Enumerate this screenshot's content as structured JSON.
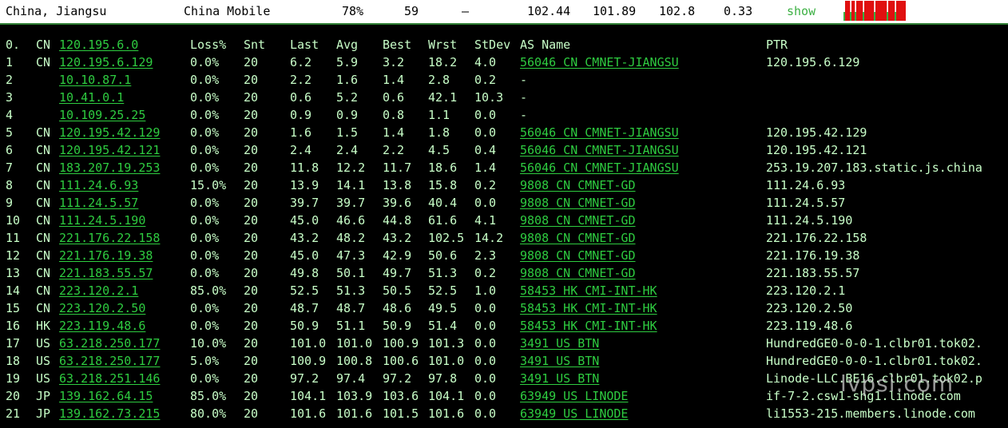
{
  "topbar": {
    "location": "China, Jiangsu",
    "carrier": "China Mobile",
    "loss": "78%",
    "sent": "59",
    "dash": "–",
    "v1": "102.44",
    "v2": "101.89",
    "v3": "102.8",
    "v4": "0.33",
    "show": "show"
  },
  "sparkline": [
    0,
    1,
    1,
    1,
    0,
    1,
    1,
    0,
    1,
    1,
    1,
    1,
    0,
    1,
    1,
    1,
    1,
    1,
    1,
    0,
    1,
    1,
    1,
    1,
    1,
    1,
    1,
    0,
    1,
    1,
    1,
    1,
    0,
    1,
    1,
    1,
    1,
    1,
    1
  ],
  "colors": {
    "bg": "#000000",
    "text": "#c8ffc8",
    "link": "#2ecc40",
    "spark_red": "#e01010",
    "spark_green": "#3cb043"
  },
  "headers": {
    "hop": "0.",
    "cc": "CN",
    "ip": "120.195.6.0",
    "loss": "Loss%",
    "snt": "Snt",
    "last": "Last",
    "avg": "Avg",
    "best": "Best",
    "wrst": "Wrst",
    "stdev": "StDev",
    "as": "AS Name",
    "ptr": "PTR"
  },
  "rows": [
    {
      "hop": "1",
      "cc": "CN",
      "ip": "120.195.6.129",
      "loss": "0.0%",
      "snt": "20",
      "last": "6.2",
      "avg": "5.9",
      "best": "3.2",
      "wrst": "18.2",
      "stdev": "4.0",
      "as": "56046 CN CMNET-JIANGSU",
      "ptr": "120.195.6.129"
    },
    {
      "hop": "2",
      "cc": "",
      "ip": "10.10.87.1",
      "loss": "0.0%",
      "snt": "20",
      "last": "2.2",
      "avg": "1.6",
      "best": "1.4",
      "wrst": "2.8",
      "stdev": "0.2",
      "as": "-",
      "ptr": ""
    },
    {
      "hop": "3",
      "cc": "",
      "ip": "10.41.0.1",
      "loss": "0.0%",
      "snt": "20",
      "last": "0.6",
      "avg": "5.2",
      "best": "0.6",
      "wrst": "42.1",
      "stdev": "10.3",
      "as": "-",
      "ptr": ""
    },
    {
      "hop": "4",
      "cc": "",
      "ip": "10.109.25.25",
      "loss": "0.0%",
      "snt": "20",
      "last": "0.9",
      "avg": "0.9",
      "best": "0.8",
      "wrst": "1.1",
      "stdev": "0.0",
      "as": "-",
      "ptr": ""
    },
    {
      "hop": "5",
      "cc": "CN",
      "ip": "120.195.42.129",
      "loss": "0.0%",
      "snt": "20",
      "last": "1.6",
      "avg": "1.5",
      "best": "1.4",
      "wrst": "1.8",
      "stdev": "0.0",
      "as": "56046 CN CMNET-JIANGSU",
      "ptr": "120.195.42.129"
    },
    {
      "hop": "6",
      "cc": "CN",
      "ip": "120.195.42.121",
      "loss": "0.0%",
      "snt": "20",
      "last": "2.4",
      "avg": "2.4",
      "best": "2.2",
      "wrst": "4.5",
      "stdev": "0.4",
      "as": "56046 CN CMNET-JIANGSU",
      "ptr": "120.195.42.121"
    },
    {
      "hop": "7",
      "cc": "CN",
      "ip": "183.207.19.253",
      "loss": "0.0%",
      "snt": "20",
      "last": "11.8",
      "avg": "12.2",
      "best": "11.7",
      "wrst": "18.6",
      "stdev": "1.4",
      "as": "56046 CN CMNET-JIANGSU",
      "ptr": "253.19.207.183.static.js.china"
    },
    {
      "hop": "8",
      "cc": "CN",
      "ip": "111.24.6.93",
      "loss": "15.0%",
      "snt": "20",
      "last": "13.9",
      "avg": "14.1",
      "best": "13.8",
      "wrst": "15.8",
      "stdev": "0.2",
      "as": "9808  CN CMNET-GD",
      "ptr": "111.24.6.93"
    },
    {
      "hop": "9",
      "cc": "CN",
      "ip": "111.24.5.57",
      "loss": "0.0%",
      "snt": "20",
      "last": "39.7",
      "avg": "39.7",
      "best": "39.6",
      "wrst": "40.4",
      "stdev": "0.0",
      "as": "9808  CN CMNET-GD",
      "ptr": "111.24.5.57"
    },
    {
      "hop": "10",
      "cc": "CN",
      "ip": "111.24.5.190",
      "loss": "0.0%",
      "snt": "20",
      "last": "45.0",
      "avg": "46.6",
      "best": "44.8",
      "wrst": "61.6",
      "stdev": "4.1",
      "as": "9808  CN CMNET-GD",
      "ptr": "111.24.5.190"
    },
    {
      "hop": "11",
      "cc": "CN",
      "ip": "221.176.22.158",
      "loss": "0.0%",
      "snt": "20",
      "last": "43.2",
      "avg": "48.2",
      "best": "43.2",
      "wrst": "102.5",
      "stdev": "14.2",
      "as": "9808  CN CMNET-GD",
      "ptr": "221.176.22.158"
    },
    {
      "hop": "12",
      "cc": "CN",
      "ip": "221.176.19.38",
      "loss": "0.0%",
      "snt": "20",
      "last": "45.0",
      "avg": "47.3",
      "best": "42.9",
      "wrst": "50.6",
      "stdev": "2.3",
      "as": "9808  CN CMNET-GD",
      "ptr": "221.176.19.38"
    },
    {
      "hop": "13",
      "cc": "CN",
      "ip": "221.183.55.57",
      "loss": "0.0%",
      "snt": "20",
      "last": "49.8",
      "avg": "50.1",
      "best": "49.7",
      "wrst": "51.3",
      "stdev": "0.2",
      "as": "9808  CN CMNET-GD",
      "ptr": "221.183.55.57"
    },
    {
      "hop": "14",
      "cc": "CN",
      "ip": "223.120.2.1",
      "loss": "85.0%",
      "snt": "20",
      "last": "52.5",
      "avg": "51.3",
      "best": "50.5",
      "wrst": "52.5",
      "stdev": "1.0",
      "as": "58453 HK CMI-INT-HK",
      "ptr": "223.120.2.1"
    },
    {
      "hop": "15",
      "cc": "CN",
      "ip": "223.120.2.50",
      "loss": "0.0%",
      "snt": "20",
      "last": "48.7",
      "avg": "48.7",
      "best": "48.6",
      "wrst": "49.5",
      "stdev": "0.0",
      "as": "58453 HK CMI-INT-HK",
      "ptr": "223.120.2.50"
    },
    {
      "hop": "16",
      "cc": "HK",
      "ip": "223.119.48.6",
      "loss": "0.0%",
      "snt": "20",
      "last": "50.9",
      "avg": "51.1",
      "best": "50.9",
      "wrst": "51.4",
      "stdev": "0.0",
      "as": "58453 HK CMI-INT-HK",
      "ptr": "223.119.48.6"
    },
    {
      "hop": "17",
      "cc": "US",
      "ip": "63.218.250.177",
      "loss": "10.0%",
      "snt": "20",
      "last": "101.0",
      "avg": "101.0",
      "best": "100.9",
      "wrst": "101.3",
      "stdev": "0.0",
      "as": "3491  US BTN",
      "ptr": "HundredGE0-0-0-1.clbr01.tok02."
    },
    {
      "hop": "18",
      "cc": "US",
      "ip": "63.218.250.177",
      "loss": "5.0%",
      "snt": "20",
      "last": "100.9",
      "avg": "100.8",
      "best": "100.6",
      "wrst": "101.0",
      "stdev": "0.0",
      "as": "3491  US BTN",
      "ptr": "HundredGE0-0-0-1.clbr01.tok02."
    },
    {
      "hop": "19",
      "cc": "US",
      "ip": "63.218.251.146",
      "loss": "0.0%",
      "snt": "20",
      "last": "97.2",
      "avg": "97.4",
      "best": "97.2",
      "wrst": "97.8",
      "stdev": "0.0",
      "as": "3491  US BTN",
      "ptr": "Linode-LLC.BE16.clbr01.tok02.p"
    },
    {
      "hop": "20",
      "cc": "JP",
      "ip": "139.162.64.15",
      "loss": "85.0%",
      "snt": "20",
      "last": "104.1",
      "avg": "103.9",
      "best": "103.6",
      "wrst": "104.1",
      "stdev": "0.0",
      "as": "63949 US LINODE",
      "ptr": "if-7-2.csw1-shg1.linode.com"
    },
    {
      "hop": "21",
      "cc": "JP",
      "ip": "139.162.73.215",
      "loss": "80.0%",
      "snt": "20",
      "last": "101.6",
      "avg": "101.6",
      "best": "101.5",
      "wrst": "101.6",
      "stdev": "0.0",
      "as": "63949 US LINODE",
      "ptr": "li1553-215.members.linode.com"
    }
  ],
  "watermark": "lvpsi.com"
}
